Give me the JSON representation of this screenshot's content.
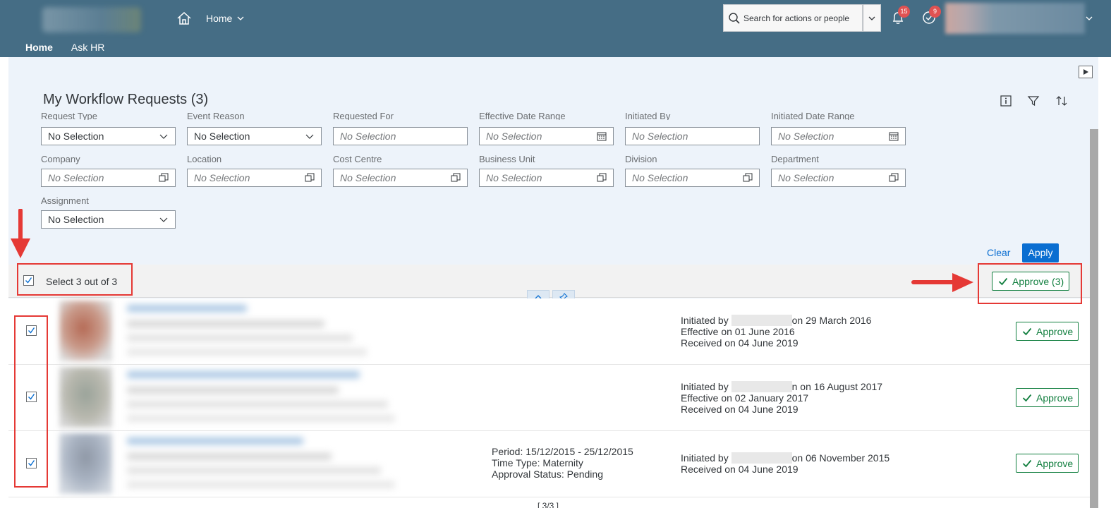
{
  "shell": {
    "home_label": "Home",
    "search_placeholder": "Search for actions or people",
    "notifications_count": "15",
    "todo_count": "9",
    "tabs": [
      "Home",
      "Ask HR"
    ]
  },
  "page": {
    "title": "My Workflow Requests (3)"
  },
  "filters": {
    "labels_row1": [
      "Request Type",
      "Event Reason",
      "Requested For",
      "Effective Date Range",
      "Initiated By",
      "Initiated Date Range"
    ],
    "values_row1": [
      "No Selection",
      "No Selection",
      "No Selection",
      "No Selection",
      "No Selection",
      "No Selection"
    ],
    "labels_row2": [
      "Company",
      "Location",
      "Cost Centre",
      "Business Unit",
      "Division",
      "Department"
    ],
    "values_row2": [
      "No Selection",
      "No Selection",
      "No Selection",
      "No Selection",
      "No Selection",
      "No Selection"
    ],
    "assignment_label": "Assignment",
    "assignment_value": "No Selection",
    "clear_label": "Clear",
    "apply_label": "Apply"
  },
  "selection": {
    "select_text": "Select 3 out of 3",
    "approve_all_label": "Approve (3)"
  },
  "requests": [
    {
      "initiated_prefix": "Initiated by",
      "initiated_suffix": "on 29 March 2016",
      "effective": "Effective on 01 June 2016",
      "received": "Received on 04 June 2019",
      "approve_label": "Approve"
    },
    {
      "initiated_prefix": "Initiated by",
      "initiated_suffix": "n on 16 August 2017",
      "effective": "Effective on 02 January 2017",
      "received": "Received on 04 June 2019",
      "approve_label": "Approve"
    },
    {
      "period": "Period: 15/12/2015 - 25/12/2015",
      "time_type": "Time Type: Maternity",
      "approval_status": "Approval Status: Pending",
      "initiated_prefix": "Initiated by",
      "initiated_suffix": "on 06 November 2015",
      "received": "Received on 04 June 2019",
      "approve_label": "Approve"
    }
  ],
  "pager": "[ 3/3 ]",
  "icons": {
    "home": "home-icon",
    "search": "search-icon",
    "bell": "bell-icon",
    "todo": "todo-check-icon",
    "info": "info-icon",
    "filter": "filter-icon",
    "sort": "sort-icon"
  },
  "colors": {
    "shell": "#456d85",
    "page_bg": "#edf3fa",
    "accent": "#0a6ed1",
    "approve": "#107e3e",
    "annotation": "#e53935"
  }
}
